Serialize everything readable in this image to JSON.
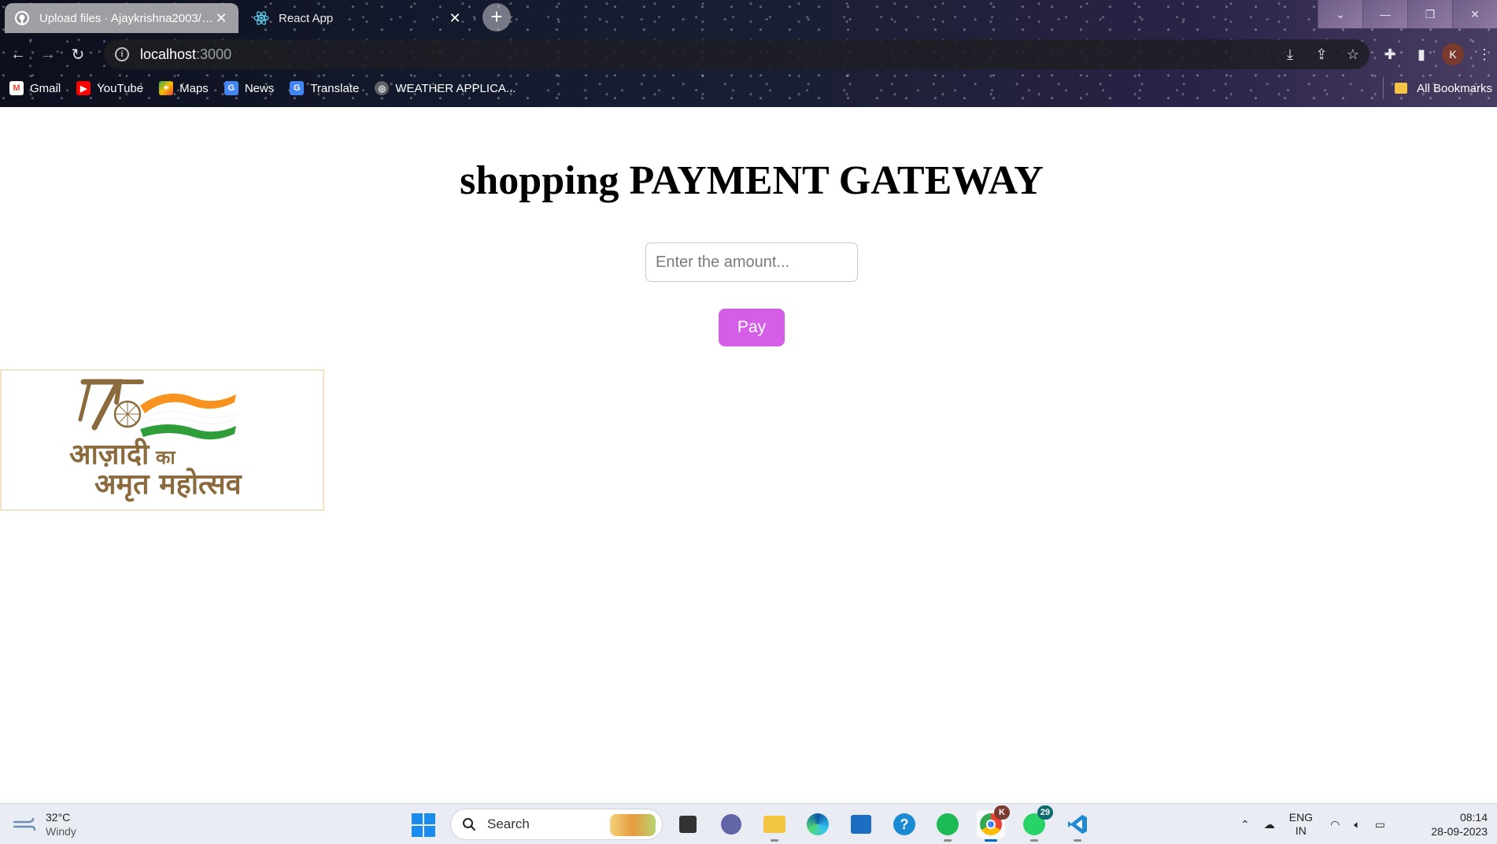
{
  "browser": {
    "tabs": [
      {
        "title": "Upload files · Ajaykrishna2003/s…",
        "active": true,
        "icon": "github-icon"
      },
      {
        "title": "React App",
        "active": false,
        "icon": "react-icon"
      }
    ],
    "new_tab_symbol": "+",
    "address": {
      "host": "localhost",
      "port": ":3000"
    },
    "profile_initial": "K",
    "bookmarks": [
      {
        "label": "Gmail",
        "icon": "gmail-icon"
      },
      {
        "label": "YouTube",
        "icon": "youtube-icon"
      },
      {
        "label": "Maps",
        "icon": "maps-icon"
      },
      {
        "label": "News",
        "icon": "news-icon"
      },
      {
        "label": "Translate",
        "icon": "translate-icon"
      },
      {
        "label": "WEATHER APPLICA...",
        "icon": "globe-icon"
      }
    ],
    "all_bookmarks": "All Bookmarks"
  },
  "page": {
    "heading": "shopping PAYMENT GATEWAY",
    "amount_placeholder": "Enter the amount...",
    "pay_button": "Pay",
    "logo": {
      "line1": "आज़ादी",
      "line1_suffix": "का",
      "line2": "अमृत महोत्सव",
      "number": "75",
      "colors": {
        "saffron": "#f7931e",
        "green": "#2e9d3a",
        "brown": "#8b6b3d"
      }
    },
    "accent_color": "#d45ee6"
  },
  "taskbar": {
    "weather": {
      "temp": "32°C",
      "condition": "Windy"
    },
    "search_label": "Search",
    "whatsapp_badge": "29",
    "chrome_badge": "K",
    "language": {
      "line1": "ENG",
      "line2": "IN"
    },
    "time": "08:14",
    "date": "28-09-2023"
  }
}
